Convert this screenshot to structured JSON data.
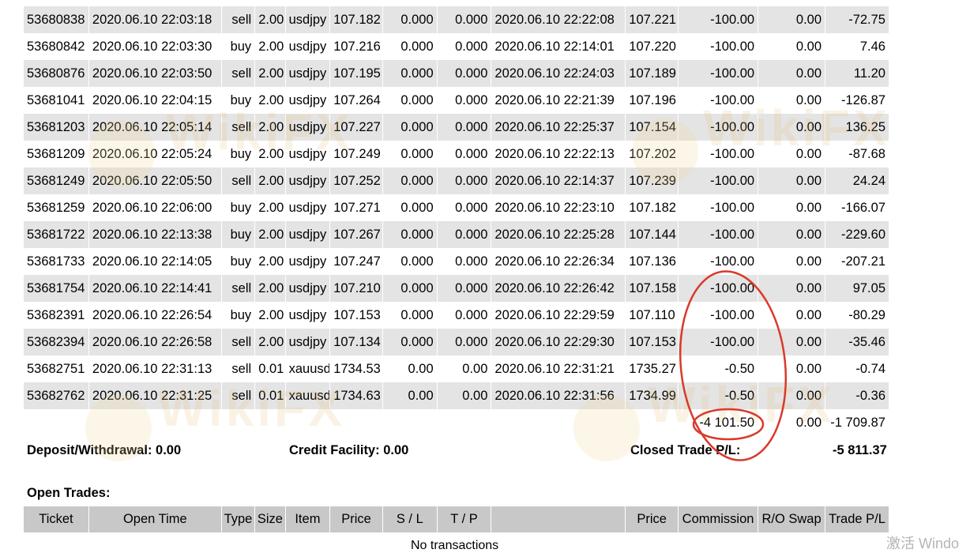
{
  "closed_trades": [
    [
      "53680838",
      "2020.06.10 22:03:18",
      "sell",
      "2.00",
      "usdjpy",
      "107.182",
      "0.000",
      "0.000",
      "2020.06.10 22:22:08",
      "107.221",
      "-100.00",
      "0.00",
      "-72.75"
    ],
    [
      "53680842",
      "2020.06.10 22:03:30",
      "buy",
      "2.00",
      "usdjpy",
      "107.216",
      "0.000",
      "0.000",
      "2020.06.10 22:14:01",
      "107.220",
      "-100.00",
      "0.00",
      "7.46"
    ],
    [
      "53680876",
      "2020.06.10 22:03:50",
      "sell",
      "2.00",
      "usdjpy",
      "107.195",
      "0.000",
      "0.000",
      "2020.06.10 22:24:03",
      "107.189",
      "-100.00",
      "0.00",
      "11.20"
    ],
    [
      "53681041",
      "2020.06.10 22:04:15",
      "buy",
      "2.00",
      "usdjpy",
      "107.264",
      "0.000",
      "0.000",
      "2020.06.10 22:21:39",
      "107.196",
      "-100.00",
      "0.00",
      "-126.87"
    ],
    [
      "53681203",
      "2020.06.10 22:05:14",
      "sell",
      "2.00",
      "usdjpy",
      "107.227",
      "0.000",
      "0.000",
      "2020.06.10 22:25:37",
      "107.154",
      "-100.00",
      "0.00",
      "136.25"
    ],
    [
      "53681209",
      "2020.06.10 22:05:24",
      "buy",
      "2.00",
      "usdjpy",
      "107.249",
      "0.000",
      "0.000",
      "2020.06.10 22:22:13",
      "107.202",
      "-100.00",
      "0.00",
      "-87.68"
    ],
    [
      "53681249",
      "2020.06.10 22:05:50",
      "sell",
      "2.00",
      "usdjpy",
      "107.252",
      "0.000",
      "0.000",
      "2020.06.10 22:14:37",
      "107.239",
      "-100.00",
      "0.00",
      "24.24"
    ],
    [
      "53681259",
      "2020.06.10 22:06:00",
      "buy",
      "2.00",
      "usdjpy",
      "107.271",
      "0.000",
      "0.000",
      "2020.06.10 22:23:10",
      "107.182",
      "-100.00",
      "0.00",
      "-166.07"
    ],
    [
      "53681722",
      "2020.06.10 22:13:38",
      "buy",
      "2.00",
      "usdjpy",
      "107.267",
      "0.000",
      "0.000",
      "2020.06.10 22:25:28",
      "107.144",
      "-100.00",
      "0.00",
      "-229.60"
    ],
    [
      "53681733",
      "2020.06.10 22:14:05",
      "buy",
      "2.00",
      "usdjpy",
      "107.247",
      "0.000",
      "0.000",
      "2020.06.10 22:26:34",
      "107.136",
      "-100.00",
      "0.00",
      "-207.21"
    ],
    [
      "53681754",
      "2020.06.10 22:14:41",
      "sell",
      "2.00",
      "usdjpy",
      "107.210",
      "0.000",
      "0.000",
      "2020.06.10 22:26:42",
      "107.158",
      "-100.00",
      "0.00",
      "97.05"
    ],
    [
      "53682391",
      "2020.06.10 22:26:54",
      "buy",
      "2.00",
      "usdjpy",
      "107.153",
      "0.000",
      "0.000",
      "2020.06.10 22:29:59",
      "107.110",
      "-100.00",
      "0.00",
      "-80.29"
    ],
    [
      "53682394",
      "2020.06.10 22:26:58",
      "sell",
      "2.00",
      "usdjpy",
      "107.134",
      "0.000",
      "0.000",
      "2020.06.10 22:29:30",
      "107.153",
      "-100.00",
      "0.00",
      "-35.46"
    ],
    [
      "53682751",
      "2020.06.10 22:31:13",
      "sell",
      "0.01",
      "xauusd",
      "1734.53",
      "0.00",
      "0.00",
      "2020.06.10 22:31:21",
      "1735.27",
      "-0.50",
      "0.00",
      "-0.74"
    ],
    [
      "53682762",
      "2020.06.10 22:31:25",
      "sell",
      "0.01",
      "xauusd",
      "1734.63",
      "0.00",
      "0.00",
      "2020.06.10 22:31:56",
      "1734.99",
      "-0.50",
      "0.00",
      "-0.36"
    ]
  ],
  "totals": {
    "commission": "-4 101.50",
    "swap": "0.00",
    "profit": "-1 709.87"
  },
  "summary": {
    "deposit": "Deposit/Withdrawal: 0.00",
    "credit": "Credit Facility: 0.00",
    "closed_label": "Closed Trade P/L:",
    "closed_value": "-5 811.37"
  },
  "open_trades": {
    "title": "Open Trades:",
    "headers": [
      "Ticket",
      "Open Time",
      "Type",
      "Size",
      "Item",
      "Price",
      "S / L",
      "T / P",
      "",
      "Price",
      "Commission",
      "R/O Swap",
      "Trade P/L"
    ],
    "empty_text": "No transactions"
  },
  "watermarks": [
    "WikiFX",
    "WikiFX",
    "WikiFX",
    "WikiFX"
  ],
  "os_watermark": "激活 Windo",
  "colors": {
    "row_alt": "#e4e4e4",
    "header_bg": "#c8c8c8",
    "annotation": "#d93a2b"
  }
}
